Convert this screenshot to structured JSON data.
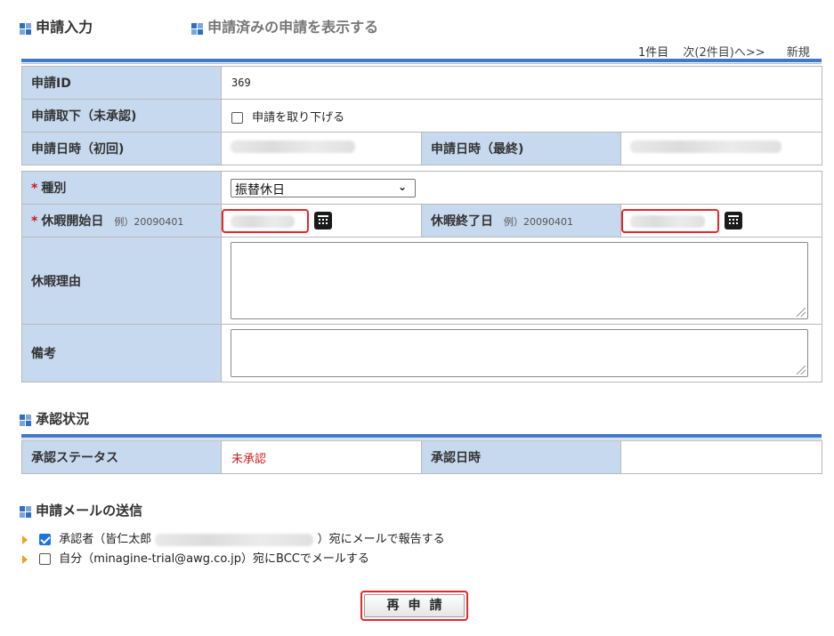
{
  "tabs": {
    "input": "申請入力",
    "view_submitted": "申請済みの申請を表示する"
  },
  "pager": {
    "count": "1件目",
    "next": "次(2件目)へ>>",
    "new": "新規"
  },
  "application": {
    "id_label": "申請ID",
    "id_value": "369",
    "withdraw_label": "申請取下（未承認)",
    "withdraw_checkbox": "申請を取り下げる",
    "date_first_label": "申請日時（初回)",
    "date_last_label": "申請日時（最終)"
  },
  "form": {
    "required_mark": "*",
    "type_label": "種別",
    "type_value": "振替休日",
    "start_label": "休暇開始日",
    "start_example": "例）20090401",
    "end_label": "休暇終了日",
    "end_example": "例）20090401",
    "reason_label": "休暇理由",
    "remarks_label": "備考"
  },
  "approval": {
    "heading": "承認状況",
    "status_label": "承認ステータス",
    "status_value": "未承認",
    "date_label": "承認日時"
  },
  "mail": {
    "heading": "申請メールの送信",
    "approver_prefix": "承認者（皆仁太郎",
    "approver_suffix": "）宛にメールで報告する",
    "approver_checked": true,
    "self_text": "自分（minagine-trial@awg.co.jp）宛にBCCでメールする",
    "self_checked": false
  },
  "submit": {
    "label": "再申請"
  },
  "colors": {
    "label_bg": "#c7d9ee",
    "accent_bar": "#3f79c7",
    "required": "#d01616",
    "highlight_border": "#e8262b",
    "status_unapproved": "#c81d1d"
  }
}
